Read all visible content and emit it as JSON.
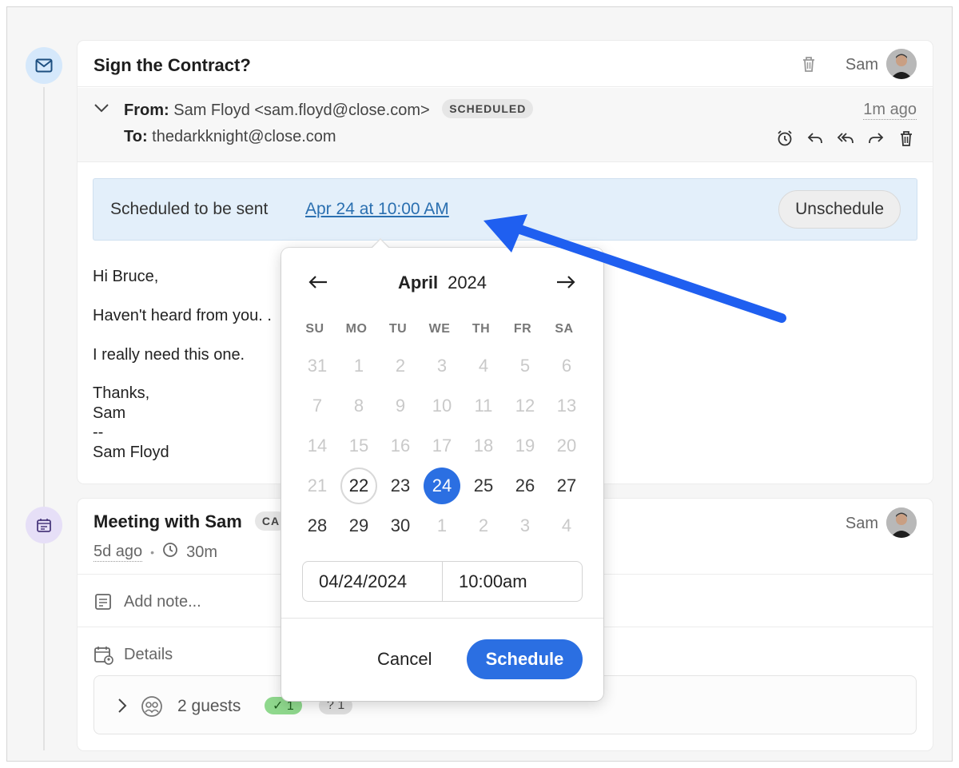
{
  "email_card": {
    "title": "Sign the Contract?",
    "owner": "Sam",
    "from_label": "From:",
    "from_value": "Sam Floyd <sam.floyd@close.com>",
    "status_badge": "SCHEDULED",
    "to_label": "To:",
    "to_value": "thedarkknight@close.com",
    "time_ago": "1m ago",
    "scheduled_text": "Scheduled to be sent",
    "scheduled_link": "Apr 24 at 10:00 AM",
    "unschedule_label": "Unschedule",
    "body": {
      "greeting": "Hi Bruce,",
      "line1": "Haven't heard from you. .",
      "line2": "I really need this one.",
      "closing": "Thanks,",
      "sig_name": "Sam",
      "sig_sep": "--",
      "sig_full": "Sam Floyd"
    }
  },
  "meeting_card": {
    "title": "Meeting with Sam",
    "badge_partial": "CA",
    "owner": "Sam",
    "time_ago": "5d ago",
    "dot": "•",
    "duration": "30m",
    "add_note": "Add note...",
    "details_label": "Details",
    "guests_label": "2 guests",
    "accepted_count": "✓ 1",
    "unknown_count": "? 1"
  },
  "datepicker": {
    "month": "April",
    "year": "2024",
    "weekdays": [
      "SU",
      "MO",
      "TU",
      "WE",
      "TH",
      "FR",
      "SA"
    ],
    "weeks": [
      [
        "31",
        "1",
        "2",
        "3",
        "4",
        "5",
        "6"
      ],
      [
        "7",
        "8",
        "9",
        "10",
        "11",
        "12",
        "13"
      ],
      [
        "14",
        "15",
        "16",
        "17",
        "18",
        "19",
        "20"
      ],
      [
        "21",
        "22",
        "23",
        "24",
        "25",
        "26",
        "27"
      ],
      [
        "28",
        "29",
        "30",
        "1",
        "2",
        "3",
        "4"
      ]
    ],
    "selected_day": "24",
    "today_day": "22",
    "date_value": "04/24/2024",
    "time_value": "10:00am",
    "cancel_label": "Cancel",
    "schedule_label": "Schedule"
  },
  "colors": {
    "accent": "#2b6fe2",
    "annotation_arrow": "#1f5ff0",
    "scheduled_bar": "#e3effa",
    "link": "#2a6fb0"
  }
}
